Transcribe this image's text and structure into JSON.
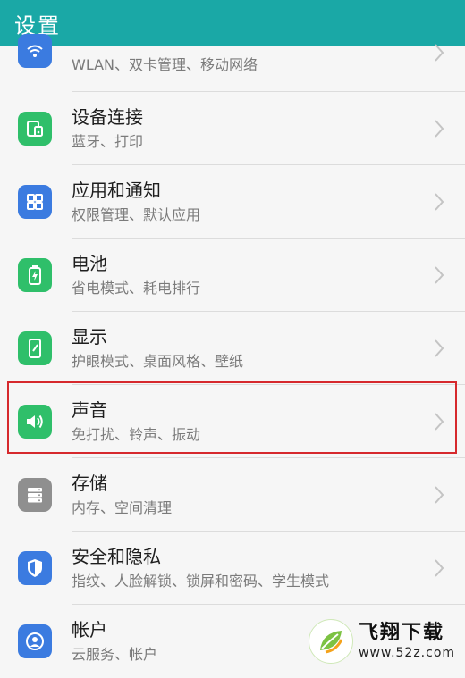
{
  "header": {
    "title": "设置"
  },
  "items": [
    {
      "title": "",
      "subtitle": "WLAN、双卡管理、移动网络",
      "icon": "wifi-icon",
      "color": "#3b7be0"
    },
    {
      "title": "设备连接",
      "subtitle": "蓝牙、打印",
      "icon": "device-connection-icon",
      "color": "#2fbf6a"
    },
    {
      "title": "应用和通知",
      "subtitle": "权限管理、默认应用",
      "icon": "apps-grid-icon",
      "color": "#3b7be0"
    },
    {
      "title": "电池",
      "subtitle": "省电模式、耗电排行",
      "icon": "battery-icon",
      "color": "#2fbf6a"
    },
    {
      "title": "显示",
      "subtitle": "护眼模式、桌面风格、壁纸",
      "icon": "display-icon",
      "color": "#2fbf6a"
    },
    {
      "title": "声音",
      "subtitle": "免打扰、铃声、振动",
      "icon": "speaker-icon",
      "color": "#2fbf6a"
    },
    {
      "title": "存储",
      "subtitle": "内存、空间清理",
      "icon": "storage-icon",
      "color": "#8f8f8f"
    },
    {
      "title": "安全和隐私",
      "subtitle": "指纹、人脸解锁、锁屏和密码、学生模式",
      "icon": "shield-icon",
      "color": "#3b7be0"
    },
    {
      "title": "帐户",
      "subtitle": "云服务、帐户",
      "icon": "account-icon",
      "color": "#3b7be0"
    }
  ],
  "highlight_color": "#d6292d",
  "watermark": {
    "name": "飞翔下载",
    "url": "www.52z.com"
  }
}
